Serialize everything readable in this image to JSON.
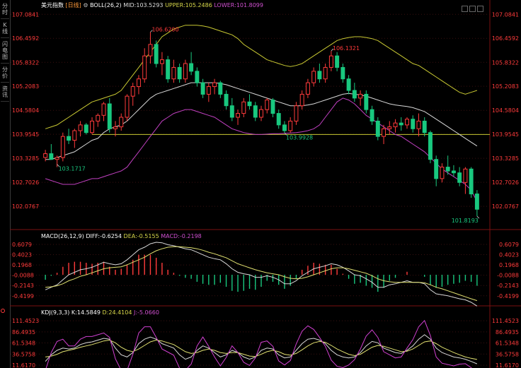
{
  "sidebar": {
    "tabs": [
      "分时",
      "K线",
      "闪电图",
      "分价",
      "资讯"
    ]
  },
  "main_legend": {
    "symbol": "美元指数",
    "period": "[日线]",
    "boll": "BOLL(26,2)",
    "mid": "MID:103.5293",
    "upper": "UPPER:105.2486",
    "lower": "LOWER:101.8099"
  },
  "macd_legend": {
    "name": "MACD(26,12,9)",
    "diff": "DIFF:-0.6254",
    "dea": "DEA:-0.5155",
    "macd": "MACD:-0.2198"
  },
  "kdj_legend": {
    "name": "KDJ(9,3,3)",
    "k": "K:14.5849",
    "d": "D:24.4104",
    "j": "J:-5.0660"
  },
  "colors": {
    "up": "#ff3b3b",
    "down": "#19c87f",
    "mid": "#d8d8d8",
    "upper": "#c8c832",
    "lower": "#c040c0",
    "hline": "#c8c832",
    "dea": "#e0e070",
    "macd": "#d040d0"
  },
  "chart_data": [
    {
      "type": "candlestick",
      "ylim": [
        101.6,
        107.2
      ],
      "y_ticks": [
        "107.0841",
        "106.4592",
        "105.8322",
        "105.2083",
        "104.5804",
        "103.9545",
        "103.3285",
        "102.7026",
        "102.0767"
      ],
      "annotations": [
        "106.6200",
        "106.1321",
        "103.9928",
        "103.1717",
        "101.8193"
      ],
      "reference_line": 103.95,
      "candles": [
        [
          103.35,
          103.55,
          103.25,
          103.45
        ],
        [
          103.45,
          103.7,
          103.3,
          103.3
        ],
        [
          103.3,
          103.4,
          103.1,
          103.35
        ],
        [
          103.35,
          104.0,
          103.25,
          103.9
        ],
        [
          103.9,
          104.1,
          103.7,
          103.8
        ],
        [
          103.8,
          104.1,
          103.6,
          104.05
        ],
        [
          104.05,
          104.3,
          103.9,
          104.2
        ],
        [
          104.2,
          104.25,
          103.95,
          104.0
        ],
        [
          104.0,
          104.4,
          103.95,
          104.3
        ],
        [
          104.3,
          104.5,
          104.15,
          104.45
        ],
        [
          104.45,
          104.8,
          104.3,
          104.75
        ],
        [
          104.75,
          104.9,
          104.0,
          104.1
        ],
        [
          104.1,
          104.3,
          103.9,
          104.15
        ],
        [
          104.15,
          104.5,
          104.05,
          104.4
        ],
        [
          104.4,
          105.0,
          104.3,
          104.95
        ],
        [
          104.95,
          105.3,
          104.7,
          105.2
        ],
        [
          105.2,
          105.5,
          105.0,
          105.4
        ],
        [
          105.4,
          106.2,
          105.3,
          106.0
        ],
        [
          106.0,
          106.62,
          105.8,
          106.3
        ],
        [
          106.3,
          106.4,
          105.7,
          105.8
        ],
        [
          105.8,
          106.1,
          105.5,
          105.9
        ],
        [
          105.9,
          106.0,
          105.3,
          105.4
        ],
        [
          105.4,
          105.9,
          105.3,
          105.7
        ],
        [
          105.7,
          105.8,
          105.3,
          105.4
        ],
        [
          105.4,
          105.9,
          105.3,
          105.8
        ],
        [
          105.8,
          106.1,
          105.5,
          105.6
        ],
        [
          105.6,
          105.7,
          105.2,
          105.3
        ],
        [
          105.3,
          105.4,
          104.9,
          105.0
        ],
        [
          105.0,
          105.3,
          104.8,
          105.2
        ],
        [
          105.2,
          105.4,
          105.0,
          105.3
        ],
        [
          105.3,
          105.35,
          104.9,
          105.0
        ],
        [
          105.0,
          105.1,
          104.6,
          104.7
        ],
        [
          104.7,
          104.9,
          104.3,
          104.4
        ],
        [
          104.4,
          104.6,
          104.2,
          104.5
        ],
        [
          104.5,
          104.9,
          104.4,
          104.8
        ],
        [
          104.8,
          105.0,
          104.6,
          104.7
        ],
        [
          104.7,
          104.8,
          104.3,
          104.4
        ],
        [
          104.4,
          104.7,
          104.3,
          104.6
        ],
        [
          104.6,
          104.9,
          104.5,
          104.85
        ],
        [
          104.85,
          104.9,
          104.4,
          104.5
        ],
        [
          104.5,
          104.6,
          104.1,
          104.2
        ],
        [
          104.2,
          104.3,
          103.99,
          104.05
        ],
        [
          104.05,
          104.4,
          104.0,
          104.3
        ],
        [
          104.3,
          104.8,
          104.2,
          104.7
        ],
        [
          104.7,
          105.1,
          104.6,
          105.0
        ],
        [
          105.0,
          105.4,
          104.9,
          105.3
        ],
        [
          105.3,
          105.7,
          105.2,
          105.6
        ],
        [
          105.6,
          105.8,
          105.3,
          105.4
        ],
        [
          105.4,
          105.8,
          105.3,
          105.7
        ],
        [
          105.7,
          106.13,
          105.6,
          106.0
        ],
        [
          106.0,
          106.1,
          105.6,
          105.7
        ],
        [
          105.7,
          105.8,
          105.3,
          105.4
        ],
        [
          105.4,
          105.5,
          105.0,
          105.1
        ],
        [
          105.1,
          105.3,
          104.8,
          104.9
        ],
        [
          104.9,
          105.1,
          104.7,
          105.0
        ],
        [
          105.0,
          105.1,
          104.5,
          104.6
        ],
        [
          104.6,
          104.7,
          104.2,
          104.3
        ],
        [
          104.3,
          104.4,
          103.8,
          103.9
        ],
        [
          103.9,
          104.2,
          103.7,
          104.1
        ],
        [
          104.1,
          104.3,
          103.95,
          104.15
        ],
        [
          104.15,
          104.35,
          104.0,
          104.25
        ],
        [
          104.25,
          104.4,
          104.05,
          104.2
        ],
        [
          104.2,
          104.4,
          104.1,
          104.35
        ],
        [
          104.35,
          104.45,
          104.0,
          104.1
        ],
        [
          104.1,
          104.5,
          103.9,
          104.3
        ],
        [
          104.3,
          104.4,
          103.9,
          104.0
        ],
        [
          104.0,
          104.05,
          103.2,
          103.3
        ],
        [
          103.3,
          103.4,
          102.6,
          102.8
        ],
        [
          102.8,
          103.2,
          102.7,
          103.1
        ],
        [
          103.1,
          103.4,
          102.9,
          103.0
        ],
        [
          103.0,
          103.15,
          102.85,
          102.95
        ],
        [
          102.95,
          103.1,
          102.6,
          102.7
        ],
        [
          102.7,
          103.1,
          102.4,
          103.05
        ],
        [
          103.05,
          103.1,
          102.3,
          102.4
        ],
        [
          102.4,
          102.5,
          101.82,
          102.0
        ]
      ],
      "boll_mid": [
        103.3,
        103.3,
        103.35,
        103.4,
        103.45,
        103.5,
        103.6,
        103.7,
        103.8,
        103.85,
        104.0,
        104.1,
        104.15,
        104.2,
        104.3,
        104.45,
        104.6,
        104.75,
        104.9,
        105.0,
        105.05,
        105.1,
        105.15,
        105.2,
        105.25,
        105.3,
        105.3,
        105.3,
        105.3,
        105.3,
        105.28,
        105.25,
        105.2,
        105.15,
        105.1,
        105.05,
        105.0,
        104.95,
        104.9,
        104.85,
        104.8,
        104.75,
        104.7,
        104.7,
        104.7,
        104.72,
        104.75,
        104.8,
        104.85,
        104.9,
        104.95,
        105.0,
        105.02,
        105.0,
        104.98,
        104.95,
        104.9,
        104.85,
        104.8,
        104.75,
        104.72,
        104.7,
        104.68,
        104.65,
        104.6,
        104.55,
        104.45,
        104.35,
        104.25,
        104.15,
        104.05,
        103.95,
        103.85,
        103.75,
        103.65
      ],
      "boll_upper": [
        104.1,
        104.15,
        104.2,
        104.3,
        104.4,
        104.5,
        104.6,
        104.7,
        104.8,
        104.85,
        104.9,
        104.95,
        105.0,
        105.1,
        105.3,
        105.5,
        105.7,
        105.9,
        106.1,
        106.3,
        106.5,
        106.6,
        106.7,
        106.75,
        106.8,
        106.8,
        106.8,
        106.78,
        106.75,
        106.7,
        106.65,
        106.6,
        106.55,
        106.45,
        106.3,
        106.2,
        106.1,
        106.0,
        105.9,
        105.85,
        105.8,
        105.75,
        105.72,
        105.75,
        105.8,
        105.9,
        106.0,
        106.1,
        106.2,
        106.3,
        106.4,
        106.45,
        106.48,
        106.5,
        106.5,
        106.48,
        106.45,
        106.4,
        106.3,
        106.2,
        106.1,
        106.0,
        105.9,
        105.8,
        105.75,
        105.65,
        105.55,
        105.45,
        105.35,
        105.25,
        105.15,
        105.05,
        105.0,
        105.05,
        105.1
      ],
      "boll_lower": [
        102.8,
        102.75,
        102.7,
        102.65,
        102.65,
        102.65,
        102.7,
        102.75,
        102.8,
        102.8,
        102.85,
        102.9,
        102.95,
        103.0,
        103.1,
        103.3,
        103.5,
        103.7,
        103.9,
        104.1,
        104.3,
        104.4,
        104.5,
        104.55,
        104.6,
        104.6,
        104.55,
        104.5,
        104.45,
        104.4,
        104.3,
        104.2,
        104.1,
        104.05,
        104.0,
        103.97,
        103.95,
        103.95,
        103.96,
        103.97,
        103.97,
        103.98,
        103.99,
        104.0,
        104.02,
        104.05,
        104.1,
        104.2,
        104.4,
        104.6,
        104.8,
        104.9,
        104.85,
        104.75,
        104.6,
        104.45,
        104.35,
        104.25,
        104.15,
        104.05,
        103.95,
        103.9,
        103.8,
        103.7,
        103.6,
        103.5,
        103.35,
        103.2,
        103.05,
        102.95,
        102.85,
        102.75,
        102.65,
        102.5,
        102.2
      ]
    },
    {
      "type": "macd",
      "ylim": [
        -0.55,
        0.72
      ],
      "y_ticks": [
        "0.6079",
        "0.4023",
        "0.1968",
        "-0.0088",
        "-0.2143",
        "-0.4199"
      ],
      "diff": [
        -0.3,
        -0.25,
        -0.2,
        -0.1,
        0.0,
        0.05,
        0.1,
        0.12,
        0.15,
        0.2,
        0.25,
        0.22,
        0.2,
        0.22,
        0.3,
        0.4,
        0.5,
        0.55,
        0.62,
        0.65,
        0.64,
        0.6,
        0.58,
        0.55,
        0.52,
        0.5,
        0.45,
        0.4,
        0.35,
        0.32,
        0.3,
        0.22,
        0.12,
        0.05,
        0.02,
        0.0,
        -0.05,
        -0.05,
        -0.02,
        -0.05,
        -0.1,
        -0.18,
        -0.18,
        -0.12,
        -0.02,
        0.05,
        0.12,
        0.15,
        0.18,
        0.22,
        0.2,
        0.15,
        0.08,
        0.0,
        -0.02,
        -0.08,
        -0.15,
        -0.25,
        -0.25,
        -0.2,
        -0.18,
        -0.15,
        -0.12,
        -0.15,
        -0.15,
        -0.18,
        -0.3,
        -0.38,
        -0.4,
        -0.42,
        -0.45,
        -0.48,
        -0.5,
        -0.55,
        -0.6254
      ],
      "dea": [
        -0.25,
        -0.24,
        -0.22,
        -0.18,
        -0.12,
        -0.08,
        -0.03,
        0.0,
        0.04,
        0.08,
        0.12,
        0.14,
        0.15,
        0.16,
        0.2,
        0.25,
        0.3,
        0.35,
        0.42,
        0.48,
        0.52,
        0.55,
        0.56,
        0.56,
        0.55,
        0.54,
        0.52,
        0.49,
        0.45,
        0.42,
        0.38,
        0.34,
        0.28,
        0.22,
        0.18,
        0.14,
        0.1,
        0.07,
        0.04,
        0.02,
        0.0,
        -0.04,
        -0.07,
        -0.08,
        -0.07,
        -0.04,
        0.0,
        0.04,
        0.08,
        0.12,
        0.14,
        0.14,
        0.12,
        0.09,
        0.06,
        0.03,
        -0.02,
        -0.08,
        -0.12,
        -0.14,
        -0.15,
        -0.15,
        -0.15,
        -0.15,
        -0.15,
        -0.16,
        -0.2,
        -0.25,
        -0.28,
        -0.32,
        -0.36,
        -0.4,
        -0.44,
        -0.48,
        -0.5155
      ]
    },
    {
      "type": "kdj",
      "ylim": [
        10,
        118
      ],
      "y_ticks": [
        "111.4523",
        "86.4935",
        "61.5348",
        "36.5758",
        "11.6170"
      ],
      "k": [
        20,
        35,
        45,
        50,
        48,
        50,
        58,
        62,
        64,
        68,
        72,
        70,
        50,
        35,
        30,
        40,
        60,
        70,
        75,
        70,
        60,
        55,
        50,
        35,
        25,
        30,
        45,
        55,
        50,
        40,
        30,
        35,
        45,
        40,
        30,
        25,
        30,
        45,
        50,
        48,
        35,
        28,
        30,
        45,
        60,
        70,
        72,
        68,
        60,
        45,
        35,
        30,
        28,
        30,
        40,
        55,
        65,
        62,
        50,
        45,
        40,
        38,
        45,
        55,
        70,
        80,
        70,
        50,
        40,
        35,
        30,
        28,
        25,
        20,
        14.58
      ],
      "d": [
        30,
        32,
        36,
        42,
        45,
        48,
        52,
        55,
        58,
        62,
        66,
        68,
        62,
        52,
        45,
        42,
        48,
        56,
        64,
        68,
        66,
        62,
        58,
        50,
        42,
        38,
        40,
        45,
        48,
        45,
        40,
        38,
        40,
        40,
        36,
        32,
        31,
        36,
        42,
        45,
        42,
        36,
        34,
        38,
        46,
        55,
        62,
        65,
        63,
        56,
        48,
        42,
        36,
        33,
        36,
        44,
        52,
        56,
        54,
        50,
        46,
        42,
        43,
        48,
        56,
        64,
        66,
        60,
        52,
        46,
        40,
        35,
        30,
        27,
        24.41
      ],
      "j": [
        0,
        40,
        65,
        70,
        55,
        55,
        70,
        76,
        76,
        80,
        84,
        74,
        26,
        0,
        0,
        36,
        84,
        98,
        98,
        74,
        48,
        41,
        34,
        5,
        0,
        14,
        55,
        75,
        54,
        30,
        10,
        29,
        55,
        40,
        18,
        11,
        28,
        63,
        66,
        54,
        21,
        12,
        22,
        59,
        88,
        100,
        92,
        74,
        54,
        23,
        9,
        6,
        12,
        24,
        48,
        77,
        91,
        74,
        42,
        35,
        28,
        30,
        50,
        69,
        98,
        112,
        78,
        30,
        16,
        13,
        10,
        14,
        15,
        6,
        -5.066
      ]
    }
  ]
}
